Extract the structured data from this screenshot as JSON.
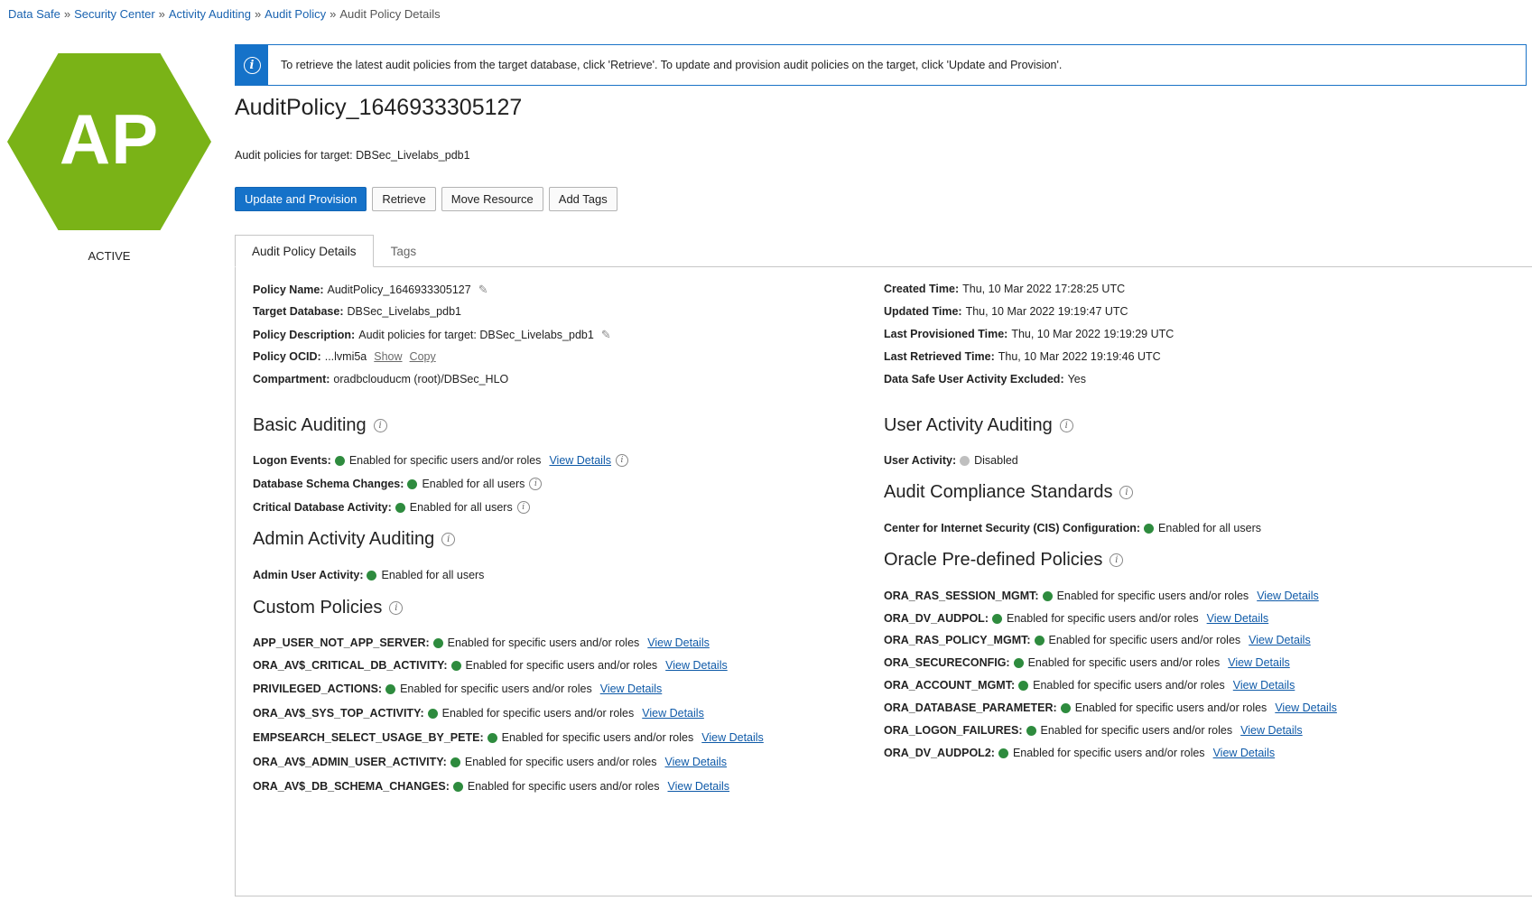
{
  "breadcrumb": {
    "items": [
      "Data Safe",
      "Security Center",
      "Activity Auditing",
      "Audit Policy"
    ],
    "current": "Audit Policy Details",
    "separator": "»"
  },
  "resource": {
    "badge_text": "AP",
    "badge_color": "#7ab317",
    "state": "ACTIVE"
  },
  "info_banner": {
    "icon": "info-icon",
    "message": "To retrieve the latest audit policies from the target database, click 'Retrieve'. To update and provision audit policies on the target, click 'Update and Provision'."
  },
  "header": {
    "title": "AuditPolicy_1646933305127",
    "subtitle": "Audit policies for target: DBSec_Livelabs_pdb1"
  },
  "actions": {
    "update_provision": "Update and Provision",
    "retrieve": "Retrieve",
    "move_resource": "Move Resource",
    "add_tags": "Add Tags"
  },
  "tabs": {
    "details": "Audit Policy Details",
    "tags": "Tags"
  },
  "details": {
    "policy_name": {
      "label": "Policy Name:",
      "value": "AuditPolicy_1646933305127"
    },
    "target_database": {
      "label": "Target Database:",
      "value": "DBSec_Livelabs_pdb1"
    },
    "policy_description": {
      "label": "Policy Description:",
      "value": "Audit policies for target: DBSec_Livelabs_pdb1"
    },
    "policy_ocid": {
      "label": "Policy OCID:",
      "value": "...lvmi5a",
      "show": "Show",
      "copy": "Copy"
    },
    "compartment": {
      "label": "Compartment:",
      "value": "oradbclouducm (root)/DBSec_HLO"
    },
    "created_time": {
      "label": "Created Time:",
      "value": "Thu, 10 Mar 2022 17:28:25 UTC"
    },
    "updated_time": {
      "label": "Updated Time:",
      "value": "Thu, 10 Mar 2022 19:19:47 UTC"
    },
    "last_provisioned": {
      "label": "Last Provisioned Time:",
      "value": "Thu, 10 Mar 2022 19:19:29 UTC"
    },
    "last_retrieved": {
      "label": "Last Retrieved Time:",
      "value": "Thu, 10 Mar 2022 19:19:46 UTC"
    },
    "user_activity_excluded": {
      "label": "Data Safe User Activity Excluded:",
      "value": "Yes"
    }
  },
  "status_colors": {
    "enabled": "#2e8b3e",
    "disabled": "#bfbfbf"
  },
  "view_details_label": "View Details",
  "basic_auditing": {
    "title": "Basic Auditing",
    "items": [
      {
        "label": "Logon Events:",
        "status": "Enabled for specific users and/or roles"
      },
      {
        "label": "Database Schema Changes:",
        "status": "Enabled for all users"
      },
      {
        "label": "Critical Database Activity:",
        "status": "Enabled for all users"
      }
    ]
  },
  "admin_auditing": {
    "title": "Admin Activity Auditing",
    "items": [
      {
        "label": "Admin User Activity:",
        "status": "Enabled for all users"
      }
    ]
  },
  "custom_policies": {
    "title": "Custom Policies",
    "items": [
      {
        "label": "APP_USER_NOT_APP_SERVER:",
        "status": "Enabled for specific users and/or roles"
      },
      {
        "label": "ORA_AV$_CRITICAL_DB_ACTIVITY:",
        "status": "Enabled for specific users and/or roles"
      },
      {
        "label": "PRIVILEGED_ACTIONS:",
        "status": "Enabled for specific users and/or roles"
      },
      {
        "label": "ORA_AV$_SYS_TOP_ACTIVITY:",
        "status": "Enabled for specific users and/or roles"
      },
      {
        "label": "EMPSEARCH_SELECT_USAGE_BY_PETE:",
        "status": "Enabled for specific users and/or roles"
      },
      {
        "label": "ORA_AV$_ADMIN_USER_ACTIVITY:",
        "status": "Enabled for specific users and/or roles"
      },
      {
        "label": "ORA_AV$_DB_SCHEMA_CHANGES:",
        "status": "Enabled for specific users and/or roles"
      }
    ]
  },
  "user_activity_auditing": {
    "title": "User Activity Auditing",
    "items": [
      {
        "label": "User Activity:",
        "status": "Disabled"
      }
    ]
  },
  "compliance_standards": {
    "title": "Audit Compliance Standards",
    "items": [
      {
        "label": "Center for Internet Security (CIS) Configuration:",
        "status": "Enabled for all users"
      }
    ]
  },
  "predefined_policies": {
    "title": "Oracle Pre-defined Policies",
    "items": [
      {
        "label": "ORA_RAS_SESSION_MGMT:",
        "status": "Enabled for specific users and/or roles"
      },
      {
        "label": "ORA_DV_AUDPOL:",
        "status": "Enabled for specific users and/or roles"
      },
      {
        "label": "ORA_RAS_POLICY_MGMT:",
        "status": "Enabled for specific users and/or roles"
      },
      {
        "label": "ORA_SECURECONFIG:",
        "status": "Enabled for specific users and/or roles"
      },
      {
        "label": "ORA_ACCOUNT_MGMT:",
        "status": "Enabled for specific users and/or roles"
      },
      {
        "label": "ORA_DATABASE_PARAMETER:",
        "status": "Enabled for specific users and/or roles"
      },
      {
        "label": "ORA_LOGON_FAILURES:",
        "status": "Enabled for specific users and/or roles"
      },
      {
        "label": "ORA_DV_AUDPOL2:",
        "status": "Enabled for specific users and/or roles"
      }
    ]
  }
}
